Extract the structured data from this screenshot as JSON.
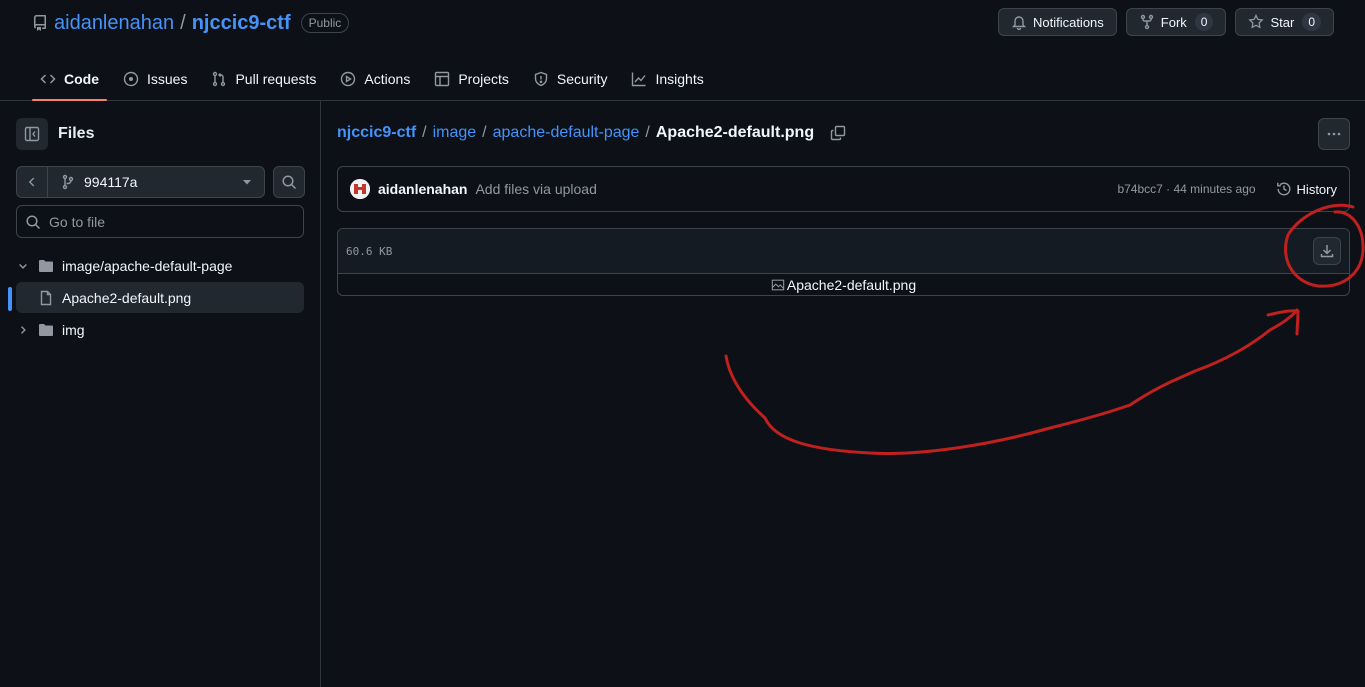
{
  "repo": {
    "owner": "aidanlenahan",
    "separator": "/",
    "name": "njccic9-ctf",
    "visibility": "Public"
  },
  "actions": {
    "notifications": "Notifications",
    "fork": {
      "label": "Fork",
      "count": "0"
    },
    "star": {
      "label": "Star",
      "count": "0"
    }
  },
  "tabs": [
    {
      "label": "Code",
      "icon": "code-icon",
      "active": true
    },
    {
      "label": "Issues",
      "icon": "issue-icon"
    },
    {
      "label": "Pull requests",
      "icon": "pull-request-icon"
    },
    {
      "label": "Actions",
      "icon": "play-icon"
    },
    {
      "label": "Projects",
      "icon": "table-icon"
    },
    {
      "label": "Security",
      "icon": "shield-icon"
    },
    {
      "label": "Insights",
      "icon": "graph-icon"
    }
  ],
  "sidebar": {
    "title": "Files",
    "branch": "994117a",
    "goto_placeholder": "Go to file",
    "tree": [
      {
        "label": "image/apache-default-page",
        "type": "folder",
        "expanded": true
      },
      {
        "label": "Apache2-default.png",
        "type": "file",
        "selected": true
      },
      {
        "label": "img",
        "type": "folder",
        "expanded": false
      }
    ]
  },
  "breadcrumb": {
    "repo": "njccic9-ctf",
    "sep": "/",
    "dir1": "image",
    "dir2": "apache-default-page",
    "file": "Apache2-default.png"
  },
  "commit": {
    "author": "aidanlenahan",
    "message": "Add files via upload",
    "meta": "b74bcc7 · 44 minutes ago",
    "history_label": "History"
  },
  "file": {
    "size": "60.6 KB",
    "image_alt": "Apache2-default.png"
  },
  "annotation": {
    "color": "#c0201e"
  }
}
